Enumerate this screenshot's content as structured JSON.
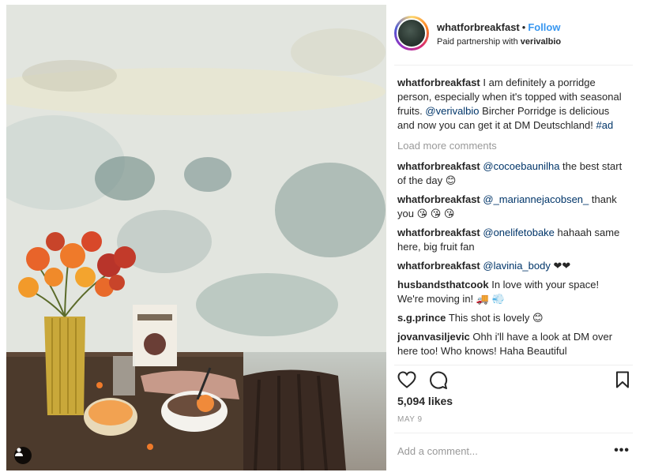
{
  "post": {
    "author": "whatforbreakfast",
    "separator": "•",
    "follow_label": "Follow",
    "partnership_prefix": "Paid partnership with",
    "partner": "verivalbio",
    "caption": {
      "user": "whatforbreakfast",
      "text_1": "I am definitely a porridge person, especially when it's topped with seasonal fruits.",
      "mention": "@verivalbio",
      "text_2": "Bircher Porridge is delicious and now you can get it at DM Deutschland!",
      "hashtag": "#ad"
    },
    "load_more_label": "Load more comments",
    "comments": [
      {
        "user": "whatforbreakfast",
        "mention": "@cocoebaunilha",
        "text": "the best start of the day 😊"
      },
      {
        "user": "whatforbreakfast",
        "mention": "@_mariannejacobsen_",
        "text": "thank you 😘 😘 😘"
      },
      {
        "user": "whatforbreakfast",
        "mention": "@onelifetobake",
        "text": "hahaah same here, big fruit fan"
      },
      {
        "user": "whatforbreakfast",
        "mention": "@lavinia_body",
        "text": "❤❤"
      },
      {
        "user": "husbandsthatcook",
        "mention": "",
        "text": "In love with your space! We're moving in! 🚚 💨"
      },
      {
        "user": "s.g.prince",
        "mention": "",
        "text": "This shot is lovely 😊"
      },
      {
        "user": "jovanvasiljevic",
        "mention": "",
        "text": "Ohh i'll have a look at DM over here too! Who knows! Haha Beautiful"
      }
    ],
    "likes": "5,094 likes",
    "date": "MAY 9",
    "add_comment_placeholder": "Add a comment...",
    "more_label": "•••"
  },
  "icons": {
    "like": "heart-outline-icon",
    "comment": "speech-bubble-icon",
    "save": "bookmark-icon",
    "user_tag": "person-icon"
  },
  "colors": {
    "link_blue": "#3897f0",
    "mention_blue": "#003569",
    "muted_gray": "#999999",
    "text": "#262626"
  }
}
